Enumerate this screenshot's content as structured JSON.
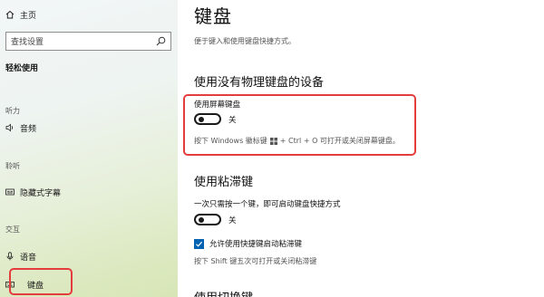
{
  "sidebar": {
    "home_label": "主页",
    "search_placeholder": "查找设置",
    "section_title": "轻松使用",
    "groups": {
      "hearing": "听力",
      "hearing_items": [
        {
          "label": "音频",
          "icon": "speaker-icon"
        }
      ],
      "listening": "聆听",
      "listening_items": [
        {
          "label": "隐藏式字幕",
          "icon": "captions-icon"
        }
      ],
      "interaction": "交互",
      "interaction_items": [
        {
          "label": "语音",
          "icon": "microphone-icon"
        },
        {
          "label": "键盘",
          "icon": "keyboard-icon",
          "selected": true
        }
      ]
    }
  },
  "main": {
    "title": "键盘",
    "description": "便于键入和使用键盘快捷方式。",
    "osk_section": {
      "heading": "使用没有物理键盘的设备",
      "label": "使用屏幕键盘",
      "toggle_state": "关",
      "hint_before": "按下 Windows 徽标键",
      "hint_after": "+ Ctrl + O 可打开或关闭屏幕键盘。"
    },
    "sticky_section": {
      "heading": "使用粘滞键",
      "label": "一次只需按一个键，即可启动键盘快捷方式",
      "toggle_state": "关",
      "checkbox_label": "允许使用快捷键启动粘滞键",
      "checkbox_checked": true,
      "hint": "按下 Shift 键五次可打开或关闭粘滞键"
    },
    "next_heading": "使用切换键"
  },
  "colors": {
    "highlight": "#e43d3d",
    "accent": "#0063b1"
  }
}
